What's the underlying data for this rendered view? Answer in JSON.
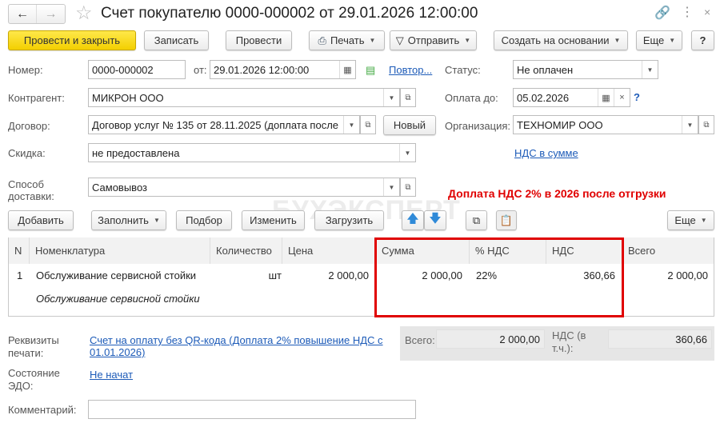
{
  "window": {
    "title": "Счет покупателю 0000-000002 от 29.01.2026 12:00:00"
  },
  "toolbar": {
    "post_close": "Провести и закрыть",
    "save": "Записать",
    "post": "Провести",
    "print": "Печать",
    "send": "Отправить",
    "create_based": "Создать на основании",
    "more": "Еще",
    "help": "?"
  },
  "form": {
    "number_label": "Номер:",
    "number": "0000-000002",
    "date_label": "от:",
    "date": "29.01.2026 12:00:00",
    "repeat_link": "Повтор...",
    "status_label": "Статус:",
    "status": "Не оплачен",
    "counterparty_label": "Контрагент:",
    "counterparty": "МИКРОН ООО",
    "pay_until_label": "Оплата до:",
    "pay_until": "05.02.2026",
    "pay_help": "?",
    "contract_label": "Договор:",
    "contract": "Договор услуг № 135 от 28.11.2025 (доплата после",
    "new_button": "Новый",
    "org_label": "Организация:",
    "org": "ТЕХНОМИР ООО",
    "discount_label": "Скидка:",
    "discount": "не предоставлена",
    "vat_link": "НДС в сумме",
    "delivery_label": "Способ доставки:",
    "delivery": "Самовывоз",
    "annotation": "Доплата НДС 2% в 2026 после отгрузки",
    "watermark": "БУХЭКСПЕРТ"
  },
  "table_toolbar": {
    "add": "Добавить",
    "fill": "Заполнить",
    "pick": "Подбор",
    "edit": "Изменить",
    "load": "Загрузить",
    "more": "Еще"
  },
  "table": {
    "columns": [
      "N",
      "Номенклатура",
      "Количество",
      "Цена",
      "Сумма",
      "% НДС",
      "НДС",
      "Всего"
    ],
    "rows": [
      {
        "n": "1",
        "item": "Обслуживание сервисной стойки",
        "item_sub": "Обслуживание сервисной стойки",
        "qty": "шт",
        "price": "2 000,00",
        "sum": "2 000,00",
        "vat_rate": "22%",
        "vat": "360,66",
        "total": "2 000,00"
      }
    ]
  },
  "footer": {
    "print_req_label": "Реквизиты печати:",
    "print_req_link": "Счет на оплату без QR-кода (Доплата 2% повышение НДС с 01.01.2026)",
    "total_label": "Всего:",
    "total": "2 000,00",
    "vat_label": "НДС (в т.ч.):",
    "vat": "360,66",
    "edo_label": "Состояние ЭДО:",
    "edo_link": "Не начат",
    "comment_label": "Комментарий:",
    "comment": ""
  },
  "colors": {
    "accent_yellow": "#f5d400",
    "highlight_red": "#e00000",
    "link": "#1d5bb8"
  }
}
